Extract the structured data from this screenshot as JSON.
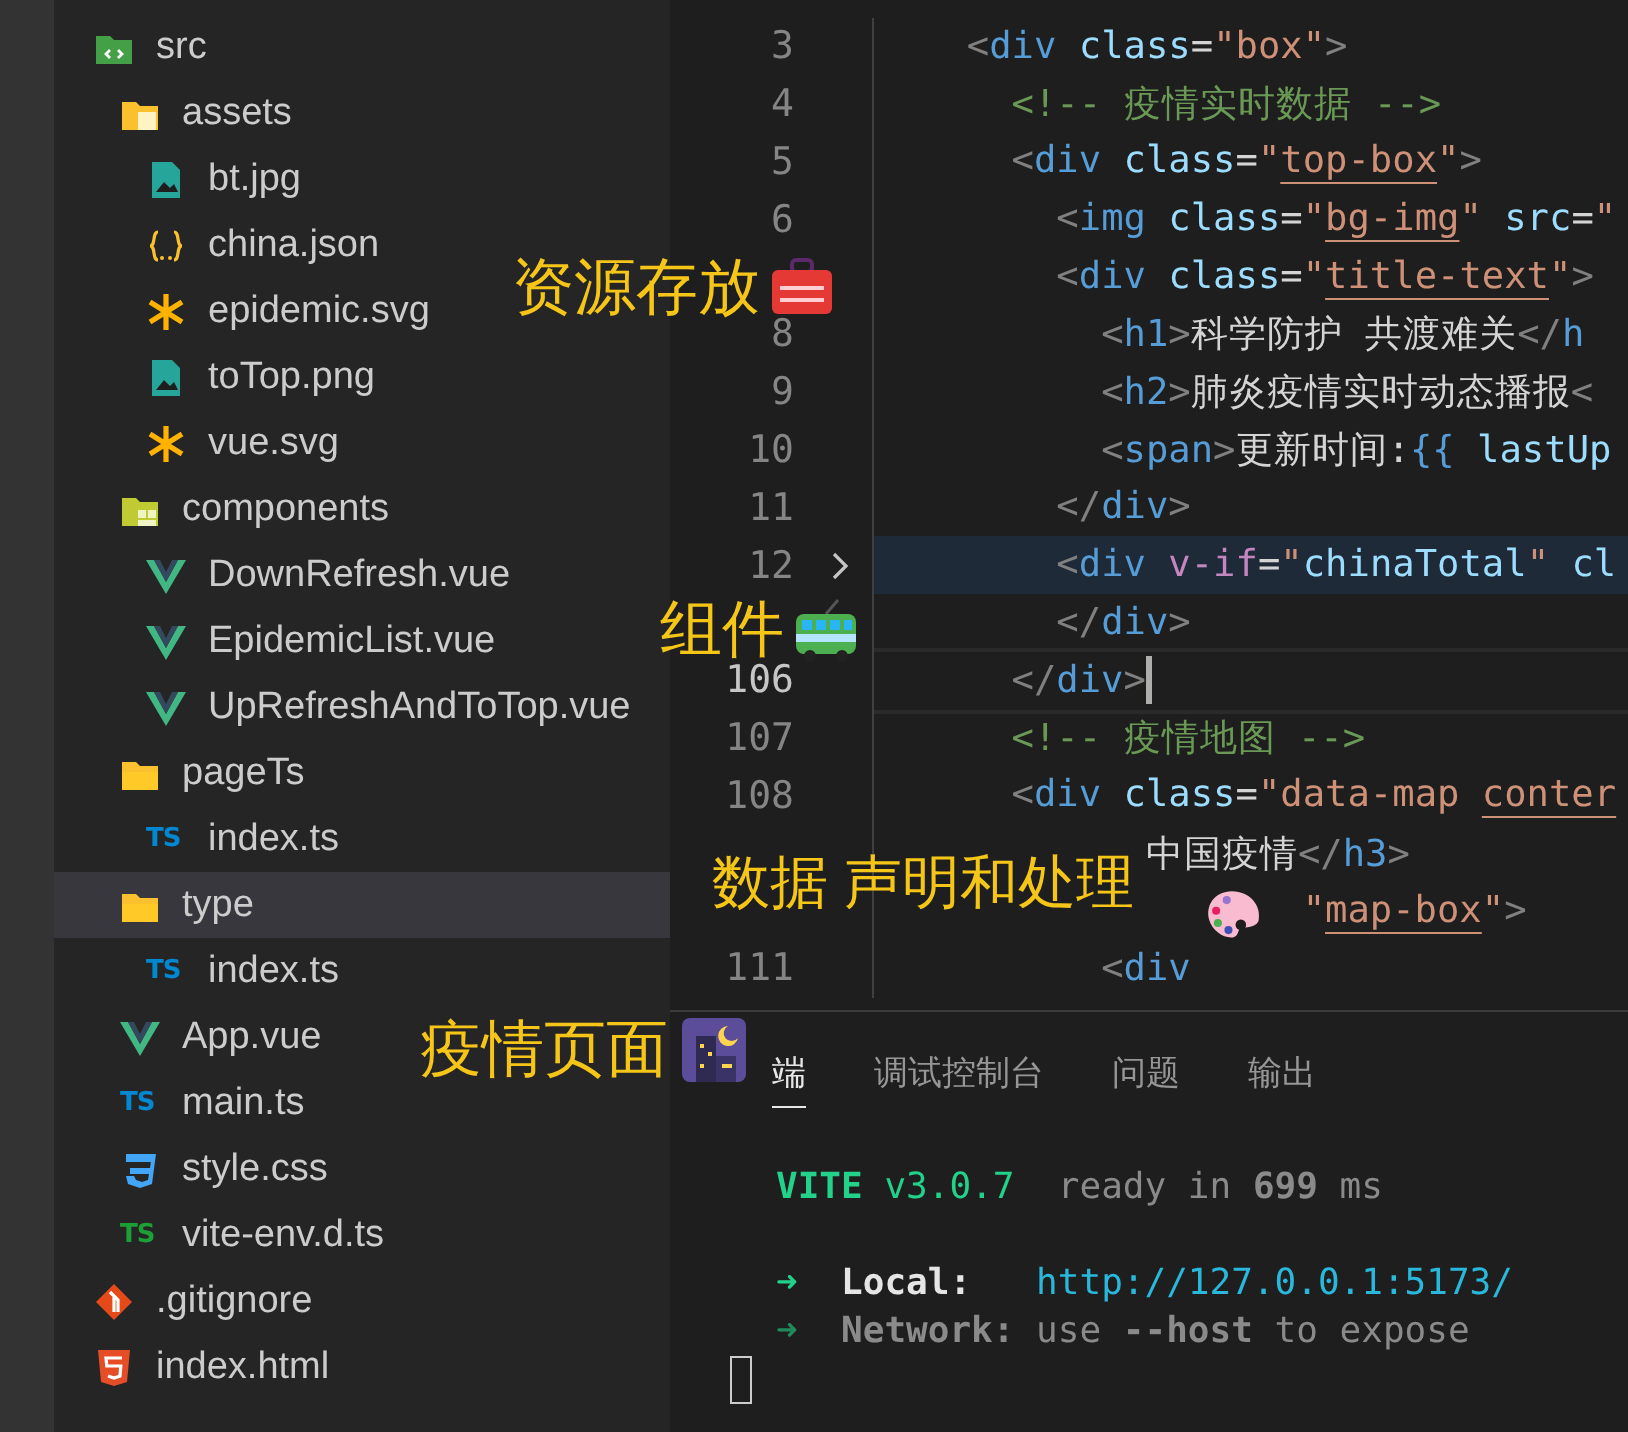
{
  "explorer": {
    "items": [
      {
        "label": "src",
        "kind": "folder-src",
        "selected": false,
        "children": [
          {
            "label": "assets",
            "kind": "folder-assets",
            "selected": false,
            "children": [
              {
                "label": "bt.jpg",
                "kind": "image",
                "selected": false
              },
              {
                "label": "china.json",
                "kind": "json",
                "selected": false
              },
              {
                "label": "epidemic.svg",
                "kind": "svg",
                "selected": false
              },
              {
                "label": "toTop.png",
                "kind": "image",
                "selected": false
              },
              {
                "label": "vue.svg",
                "kind": "svg",
                "selected": false
              }
            ]
          },
          {
            "label": "components",
            "kind": "folder-components",
            "selected": false,
            "children": [
              {
                "label": "DownRefresh.vue",
                "kind": "vue",
                "selected": false
              },
              {
                "label": "EpidemicList.vue",
                "kind": "vue",
                "selected": false
              },
              {
                "label": "UpRefreshAndToTop.vue",
                "kind": "vue",
                "selected": false
              }
            ]
          },
          {
            "label": "pageTs",
            "kind": "folder",
            "selected": false,
            "children": [
              {
                "label": "index.ts",
                "kind": "ts",
                "badge": "TS",
                "selected": false
              }
            ]
          },
          {
            "label": "type",
            "kind": "folder",
            "selected": true,
            "children": [
              {
                "label": "index.ts",
                "kind": "ts",
                "badge": "TS",
                "selected": false
              }
            ]
          },
          {
            "label": "App.vue",
            "kind": "vue",
            "selected": false
          },
          {
            "label": "main.ts",
            "kind": "ts",
            "badge": "TS",
            "selected": false
          },
          {
            "label": "style.css",
            "kind": "css",
            "selected": false
          },
          {
            "label": "vite-env.d.ts",
            "kind": "ts-env",
            "badge": "TS",
            "selected": false
          }
        ]
      },
      {
        "label": ".gitignore",
        "kind": "git",
        "selected": false
      },
      {
        "label": "index.html",
        "kind": "html",
        "selected": false
      }
    ]
  },
  "editor": {
    "lines": [
      {
        "number": "3",
        "kind": "normal",
        "tokens": [
          {
            "kind": "punct",
            "text": "  <"
          },
          {
            "kind": "tag",
            "text": "div"
          },
          {
            "kind": "attr",
            "text": " class"
          },
          {
            "kind": "text",
            "text": "="
          },
          {
            "kind": "str",
            "text": "\"box\""
          },
          {
            "kind": "punct",
            "text": ">"
          }
        ]
      },
      {
        "number": "4",
        "kind": "normal",
        "tokens": [
          {
            "kind": "comment",
            "text": "    <!-- 疫情实时数据 -->"
          }
        ]
      },
      {
        "number": "5",
        "kind": "normal",
        "tokens": [
          {
            "kind": "punct",
            "text": "    <"
          },
          {
            "kind": "tag",
            "text": "div"
          },
          {
            "kind": "attr",
            "text": " class"
          },
          {
            "kind": "text",
            "text": "="
          },
          {
            "kind": "str",
            "text": "\""
          },
          {
            "kind": "link",
            "text": "top-box"
          },
          {
            "kind": "str",
            "text": "\""
          },
          {
            "kind": "punct",
            "text": ">"
          }
        ]
      },
      {
        "number": "6",
        "kind": "normal",
        "tokens": [
          {
            "kind": "punct",
            "text": "      <"
          },
          {
            "kind": "tag",
            "text": "img"
          },
          {
            "kind": "attr",
            "text": " class"
          },
          {
            "kind": "text",
            "text": "="
          },
          {
            "kind": "str",
            "text": "\""
          },
          {
            "kind": "link",
            "text": "bg-img"
          },
          {
            "kind": "str",
            "text": "\""
          },
          {
            "kind": "attr",
            "text": " src"
          },
          {
            "kind": "text",
            "text": "="
          },
          {
            "kind": "str",
            "text": "\""
          }
        ]
      },
      {
        "kind": "normal",
        "tokens": [
          {
            "kind": "punct",
            "text": "      <"
          },
          {
            "kind": "tag",
            "text": "div"
          },
          {
            "kind": "attr",
            "text": " class"
          },
          {
            "kind": "text",
            "text": "="
          },
          {
            "kind": "str",
            "text": "\""
          },
          {
            "kind": "link",
            "text": "title-text"
          },
          {
            "kind": "str",
            "text": "\""
          },
          {
            "kind": "punct",
            "text": ">"
          }
        ]
      },
      {
        "number": "8",
        "kind": "normal",
        "tokens": [
          {
            "kind": "punct",
            "text": "        <"
          },
          {
            "kind": "tag",
            "text": "h1"
          },
          {
            "kind": "punct",
            "text": ">"
          },
          {
            "kind": "text",
            "text": "科学防护 共渡难关"
          },
          {
            "kind": "punct",
            "text": "</"
          },
          {
            "kind": "tag",
            "text": "h"
          }
        ]
      },
      {
        "number": "9",
        "kind": "normal",
        "tokens": [
          {
            "kind": "punct",
            "text": "        <"
          },
          {
            "kind": "tag",
            "text": "h2"
          },
          {
            "kind": "punct",
            "text": ">"
          },
          {
            "kind": "text",
            "text": "肺炎疫情实时动态播报"
          },
          {
            "kind": "punct",
            "text": "<"
          }
        ]
      },
      {
        "number": "10",
        "kind": "normal",
        "tokens": [
          {
            "kind": "punct",
            "text": "        <"
          },
          {
            "kind": "tag",
            "text": "span"
          },
          {
            "kind": "punct",
            "text": ">"
          },
          {
            "kind": "text",
            "text": "更新时间:"
          },
          {
            "kind": "tag",
            "text": "{{"
          },
          {
            "kind": "attr",
            "text": " lastUp"
          }
        ]
      },
      {
        "number": "11",
        "kind": "normal",
        "tokens": [
          {
            "kind": "punct",
            "text": "      </"
          },
          {
            "kind": "tag",
            "text": "div"
          },
          {
            "kind": "punct",
            "text": ">"
          }
        ]
      },
      {
        "number": "12",
        "kind": "folded",
        "tokens": [
          {
            "kind": "punct",
            "text": "      <"
          },
          {
            "kind": "tag",
            "text": "div"
          },
          {
            "kind": "directive",
            "text": " v-if"
          },
          {
            "kind": "text",
            "text": "="
          },
          {
            "kind": "str",
            "text": "\""
          },
          {
            "kind": "attr",
            "text": "chinaTotal"
          },
          {
            "kind": "str",
            "text": "\""
          },
          {
            "kind": "attr",
            "text": " cl"
          }
        ]
      },
      {
        "kind": "normal",
        "tokens": [
          {
            "kind": "punct",
            "text": "      </"
          },
          {
            "kind": "tag",
            "text": "div"
          },
          {
            "kind": "punct",
            "text": ">"
          }
        ]
      },
      {
        "number": "106",
        "kind": "current",
        "tokens": [
          {
            "kind": "punct",
            "text": "    </"
          },
          {
            "kind": "tag",
            "text": "div"
          },
          {
            "kind": "punct",
            "text": ">"
          }
        ]
      },
      {
        "number": "107",
        "kind": "normal",
        "tokens": [
          {
            "kind": "comment",
            "text": "    <!-- 疫情地图 -->"
          }
        ]
      },
      {
        "number": "108",
        "kind": "normal",
        "tokens": [
          {
            "kind": "punct",
            "text": "    <"
          },
          {
            "kind": "tag",
            "text": "div"
          },
          {
            "kind": "attr",
            "text": " class"
          },
          {
            "kind": "text",
            "text": "="
          },
          {
            "kind": "str",
            "text": "\"data-map "
          },
          {
            "kind": "link",
            "text": "conter"
          }
        ]
      },
      {
        "kind": "normal",
        "tokens": [
          {
            "kind": "text",
            "text": "          中国疫情"
          },
          {
            "kind": "punct",
            "text": "</"
          },
          {
            "kind": "tag",
            "text": "h3"
          },
          {
            "kind": "punct",
            "text": ">"
          }
        ]
      },
      {
        "kind": "normal",
        "tokens": [
          {
            "kind": "str",
            "text": "                 \""
          },
          {
            "kind": "link",
            "text": "map-box"
          },
          {
            "kind": "str",
            "text": "\""
          },
          {
            "kind": "punct",
            "text": ">"
          }
        ]
      },
      {
        "number": "111",
        "kind": "normal",
        "tokens": [
          {
            "kind": "punct",
            "text": "        <"
          },
          {
            "kind": "tag",
            "text": "div"
          }
        ]
      }
    ]
  },
  "panel": {
    "tabs": [
      {
        "label": "端",
        "selected": true
      },
      {
        "label": "调试控制台",
        "selected": false
      },
      {
        "label": "问题",
        "selected": false
      },
      {
        "label": "输出",
        "selected": false
      }
    ],
    "terminal": [
      {
        "kind": "gap-after",
        "tokens": [
          {
            "kind": "green-bold",
            "text": "VITE"
          },
          {
            "kind": "green",
            "text": " v3.0.7"
          },
          {
            "kind": "dim",
            "text": "  ready in "
          },
          {
            "kind": "dim-bold",
            "text": "699"
          },
          {
            "kind": "dim",
            "text": " ms"
          }
        ]
      },
      {
        "kind": "normal",
        "tokens": [
          {
            "kind": "green-bold",
            "text": "➜"
          },
          {
            "kind": "white-bold",
            "text": "  Local:"
          },
          {
            "kind": "url",
            "text": "   http://127.0.0.1:5173/"
          }
        ]
      },
      {
        "kind": "normal",
        "tokens": [
          {
            "kind": "darkgreen-bold",
            "text": "➜"
          },
          {
            "kind": "dim-bold",
            "text": "  Network:"
          },
          {
            "kind": "dim",
            "text": " use "
          },
          {
            "kind": "dim-bold",
            "text": "--host"
          },
          {
            "kind": "dim",
            "text": " to expose"
          }
        ]
      }
    ]
  },
  "annotations": [
    {
      "text": "资源存放"
    },
    {
      "text": "组件"
    },
    {
      "text": "数据 声明和处理"
    },
    {
      "text": "疫情页面"
    }
  ]
}
